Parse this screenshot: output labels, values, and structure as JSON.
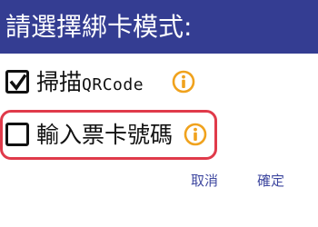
{
  "dialog": {
    "title": "請選擇綁卡模式:"
  },
  "options": [
    {
      "label_cjk": "掃描",
      "label_latin": "QRCode",
      "checked": true,
      "info_icon": "info-icon"
    },
    {
      "label_cjk": "輸入票卡號碼",
      "label_latin": "",
      "checked": false,
      "info_icon": "info-icon"
    }
  ],
  "buttons": {
    "cancel": "取消",
    "confirm": "確定"
  },
  "colors": {
    "title_bar": "#343d92",
    "button_text": "#3f48a0",
    "info_icon": "#f0a21d",
    "highlight_border": "#e03a4a"
  }
}
